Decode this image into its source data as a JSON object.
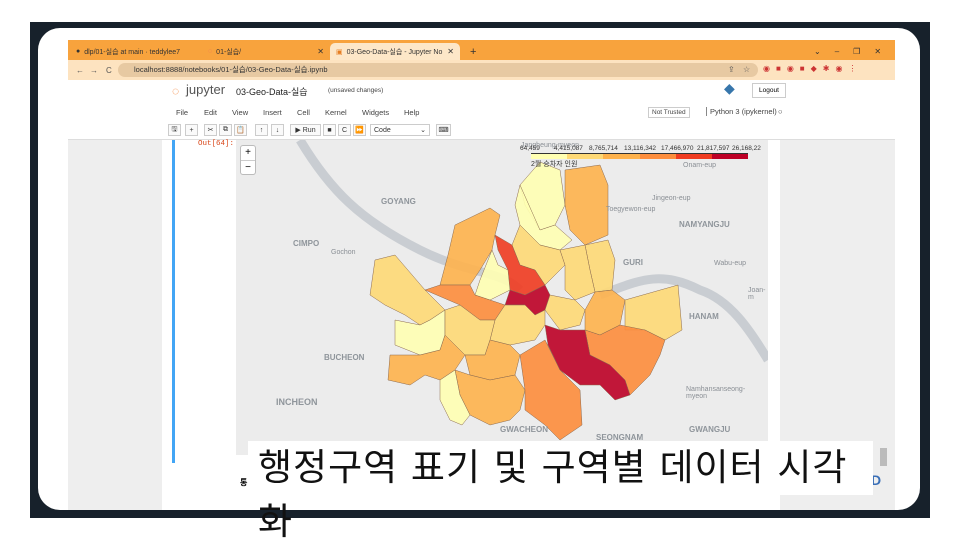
{
  "browser": {
    "tabs": [
      {
        "label": "dlp/01-실습 at main · teddylee7",
        "icon": "github-icon"
      },
      {
        "label": "01-실습/",
        "icon": "loading-icon"
      },
      {
        "label": "03-Geo-Data-실습 - Jupyter No",
        "icon": "jupyter-icon",
        "active": true
      }
    ],
    "new_tab": "+",
    "url": "localhost:8888/notebooks/01-실습/03-Geo-Data-실습.ipynb"
  },
  "jupyter": {
    "logo": "jupyter",
    "notebook_title": "03-Geo-Data-실습",
    "status": "(unsaved changes)",
    "logout": "Logout",
    "menu": [
      "File",
      "Edit",
      "View",
      "Insert",
      "Cell",
      "Kernel",
      "Widgets",
      "Help"
    ],
    "not_trusted": "Not Trusted",
    "kernel": "Python 3 (ipykernel)",
    "toolbar": {
      "run": "Run",
      "cell_type": "Code"
    },
    "out_prompt": "Out[64]:",
    "next_cell_text": "통"
  },
  "map": {
    "zoom_in": "+",
    "zoom_out": "−",
    "legend": {
      "title": "2월 승차자 인원",
      "ticks": [
        "64,459",
        "4,415,087",
        "8,765,714",
        "13,116,342",
        "17,466,970",
        "21,817,597",
        "26,168,22"
      ],
      "colors": [
        "#ffffb2",
        "#fed976",
        "#feb24c",
        "#fd8d3c",
        "#f03b20",
        "#bd0026"
      ]
    },
    "places": [
      "Jangheung-myeon",
      "GOYANG",
      "CIMPO",
      "Gochon",
      "BUCHEON",
      "INCHEON",
      "GWACHEON",
      "SEONGNAM",
      "GWANGJU",
      "HANAM",
      "NAMYANGJU",
      "GURI",
      "Wabu-eup",
      "Joan-m",
      "Jingeon-eup",
      "Toegyewon-eup",
      "Namhansanseong-myeon",
      "Onam-eup"
    ]
  },
  "subtitle": "행정구역 표기 및 구역별 데이터 시각화"
}
